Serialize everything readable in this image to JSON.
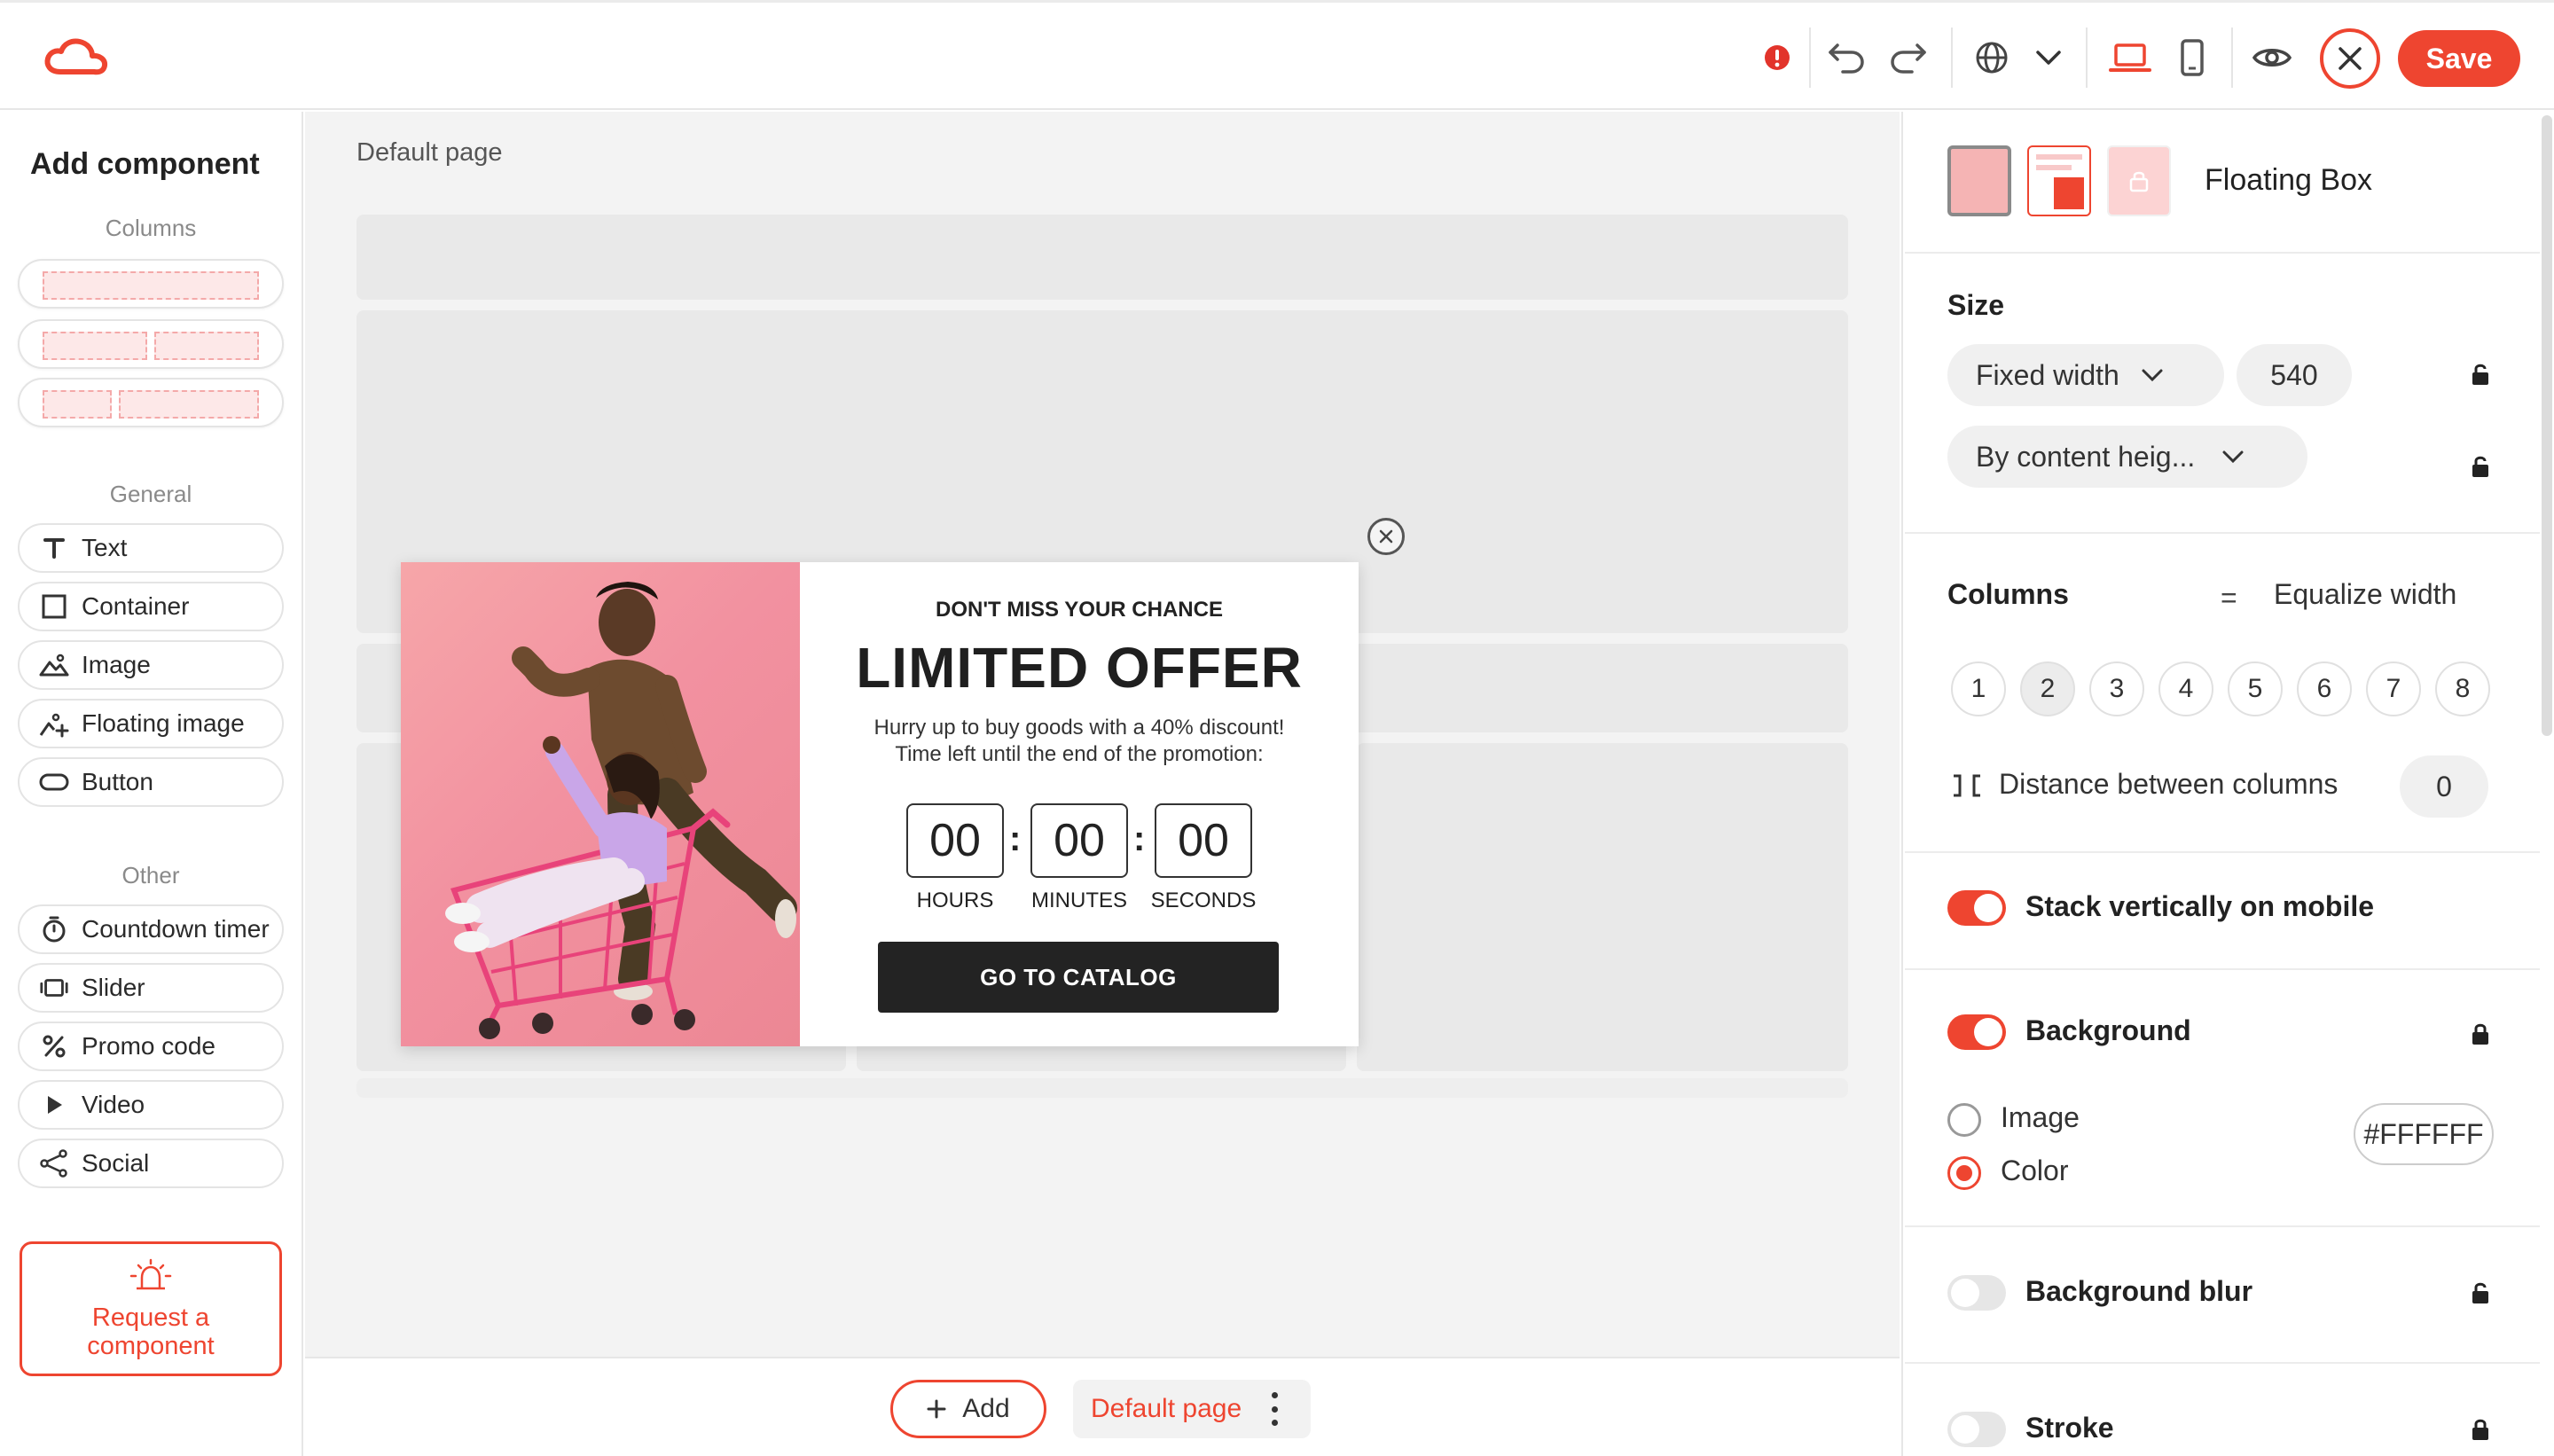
{
  "topbar": {
    "save_label": "Save",
    "accent": "#ee4530"
  },
  "left": {
    "title": "Add component",
    "columns_label": "Columns",
    "general_label": "General",
    "other_label": "Other",
    "general_items": [
      {
        "label": "Text",
        "icon": "text-icon"
      },
      {
        "label": "Container",
        "icon": "container-icon"
      },
      {
        "label": "Image",
        "icon": "image-icon"
      },
      {
        "label": "Floating image",
        "icon": "floating-image-icon"
      },
      {
        "label": "Button",
        "icon": "button-icon"
      }
    ],
    "other_items": [
      {
        "label": "Countdown timer",
        "icon": "timer-icon"
      },
      {
        "label": "Slider",
        "icon": "slider-icon"
      },
      {
        "label": "Promo code",
        "icon": "percent-icon"
      },
      {
        "label": "Video",
        "icon": "play-icon"
      },
      {
        "label": "Social",
        "icon": "share-icon"
      }
    ],
    "request_label": "Request a component"
  },
  "canvas": {
    "page_label": "Default page",
    "popup": {
      "kicker": "DON'T MISS YOUR CHANCE",
      "title": "LIMITED OFFER",
      "desc_line1": "Hurry up to buy goods with a 40% discount!",
      "desc_line2": "Time left until the end of the promotion:",
      "timer": [
        {
          "value": "00",
          "label": "HOURS"
        },
        {
          "value": "00",
          "label": "MINUTES"
        },
        {
          "value": "00",
          "label": "SECONDS"
        }
      ],
      "button_label": "GO TO CATALOG"
    }
  },
  "bottombar": {
    "add_label": "Add",
    "page_chip": "Default page"
  },
  "right": {
    "title": "Floating Box",
    "size_label": "Size",
    "width_mode": "Fixed width",
    "width_value": "540",
    "height_mode": "By content heig...",
    "columns_label": "Columns",
    "equalize_label": "Equalize width",
    "column_numbers": [
      "1",
      "2",
      "3",
      "4",
      "5",
      "6",
      "7",
      "8"
    ],
    "selected_columns": "2",
    "distance_label": "Distance between columns",
    "distance_value": "0",
    "stack_label": "Stack vertically on mobile",
    "stack_on": true,
    "background_label": "Background",
    "background_on": true,
    "bg_image_label": "Image",
    "bg_color_label": "Color",
    "bg_color_value": "#FFFFFF",
    "blur_label": "Background blur",
    "blur_on": false,
    "stroke_label": "Stroke",
    "stroke_on": false
  }
}
